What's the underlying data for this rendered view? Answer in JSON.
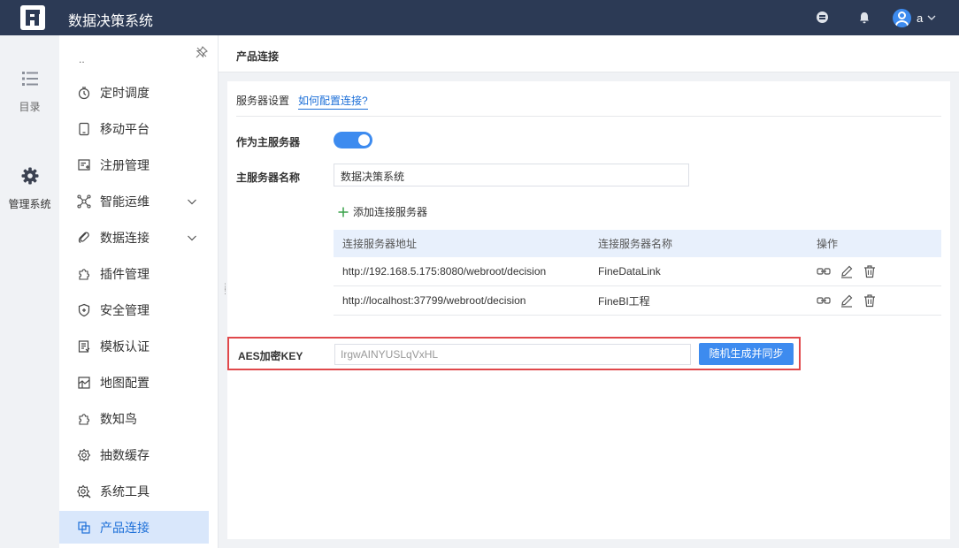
{
  "app": {
    "title": "数据决策系统",
    "user": "a"
  },
  "rail": [
    {
      "label": "目录",
      "icon": "list-icon"
    },
    {
      "label": "管理系统",
      "icon": "gear-icon"
    }
  ],
  "menu": {
    "collapsed_hint": "..",
    "items": [
      {
        "label": "定时调度",
        "icon": "timer-icon"
      },
      {
        "label": "移动平台",
        "icon": "tablet-icon"
      },
      {
        "label": "注册管理",
        "icon": "register-icon"
      },
      {
        "label": "智能运维",
        "icon": "network-icon",
        "expandable": true
      },
      {
        "label": "数据连接",
        "icon": "link-icon",
        "expandable": true
      },
      {
        "label": "插件管理",
        "icon": "puzzle-icon"
      },
      {
        "label": "安全管理",
        "icon": "shield-icon"
      },
      {
        "label": "模板认证",
        "icon": "template-icon"
      },
      {
        "label": "地图配置",
        "icon": "map-icon"
      },
      {
        "label": "数知鸟",
        "icon": "bird-icon"
      },
      {
        "label": "抽数缓存",
        "icon": "cache-icon"
      },
      {
        "label": "系统工具",
        "icon": "tools-icon"
      },
      {
        "label": "产品连接",
        "icon": "product-link-icon",
        "active": true
      }
    ]
  },
  "page": {
    "title": "产品连接",
    "section_title": "服务器设置",
    "help_link": "如何配置连接?",
    "master_label": "作为主服务器",
    "master_enabled": true,
    "name_label": "主服务器名称",
    "name_value": "数据决策系统",
    "add_server": "添加连接服务器",
    "table": {
      "headers": [
        "连接服务器地址",
        "连接服务器名称",
        "操作"
      ],
      "rows": [
        {
          "address": "http://192.168.5.175:8080/webroot/decision",
          "name": "FineDataLink"
        },
        {
          "address": "http://localhost:37799/webroot/decision",
          "name": "FineBI工程"
        }
      ]
    },
    "aes_label": "AES加密KEY",
    "aes_value": "IrgwAINYUSLqVxHL",
    "aes_button": "随机生成并同步"
  },
  "colors": {
    "topbar": "#2c3a55",
    "accent": "#3d8bef",
    "highlight_border": "#e0484b",
    "active_menu_bg": "#d9e7fb"
  }
}
